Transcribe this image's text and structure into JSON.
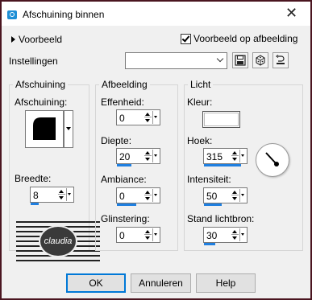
{
  "window": {
    "title": "Afschuining binnen"
  },
  "top": {
    "preview_toggle": "Voorbeeld",
    "preview_on_image_label": "Voorbeeld op afbeelding",
    "preview_on_image_checked": true,
    "settings_label": "Instellingen",
    "settings_value": ""
  },
  "groups": {
    "bevel": {
      "title": "Afschuining",
      "bevel_label": "Afschuining:",
      "width_label": "Breedte:",
      "width_value": "8"
    },
    "image": {
      "title": "Afbeelding",
      "smoothness_label": "Effenheid:",
      "smoothness_value": "0",
      "depth_label": "Diepte:",
      "depth_value": "20",
      "ambience_label": "Ambiance:",
      "ambience_value": "0",
      "shininess_label": "Glinstering:",
      "shininess_value": "0"
    },
    "light": {
      "title": "Licht",
      "color_label": "Kleur:",
      "color_value": "#ffffff",
      "angle_label": "Hoek:",
      "angle_value": "315",
      "intensity_label": "Intensiteit:",
      "intensity_value": "50",
      "elevation_label": "Stand lichtbron:",
      "elevation_value": "30"
    }
  },
  "watermark": {
    "text": "claudia"
  },
  "buttons": {
    "ok": "OK",
    "cancel": "Annuleren",
    "help": "Help"
  },
  "icons": {
    "save": "save-icon",
    "random": "dice-icon",
    "manage": "manage-presets-icon",
    "close": "close-icon"
  },
  "colors": {
    "accent": "#1f7fe0",
    "frame": "#4a1520"
  }
}
